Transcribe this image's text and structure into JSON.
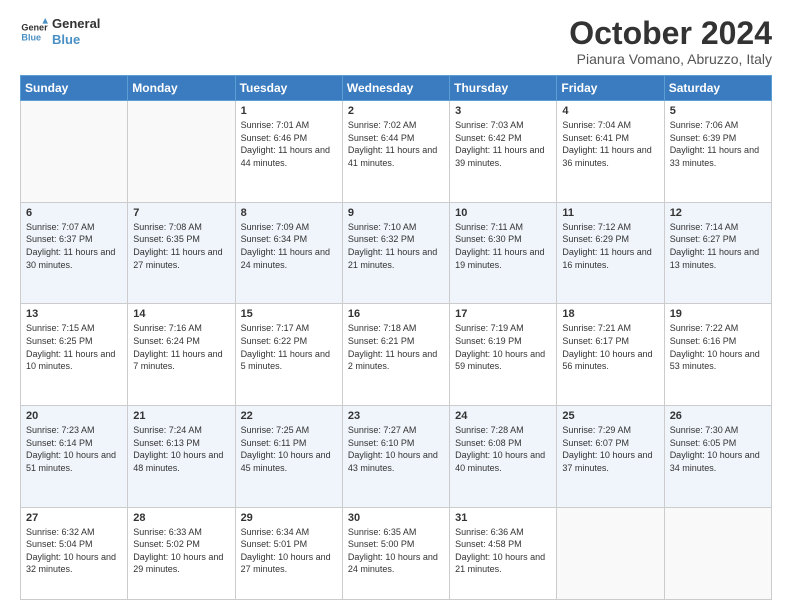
{
  "logo": {
    "line1": "General",
    "line2": "Blue"
  },
  "title": "October 2024",
  "location": "Pianura Vomano, Abruzzo, Italy",
  "weekdays": [
    "Sunday",
    "Monday",
    "Tuesday",
    "Wednesday",
    "Thursday",
    "Friday",
    "Saturday"
  ],
  "weeks": [
    [
      {
        "day": "",
        "sunrise": "",
        "sunset": "",
        "daylight": ""
      },
      {
        "day": "",
        "sunrise": "",
        "sunset": "",
        "daylight": ""
      },
      {
        "day": "1",
        "sunrise": "Sunrise: 7:01 AM",
        "sunset": "Sunset: 6:46 PM",
        "daylight": "Daylight: 11 hours and 44 minutes."
      },
      {
        "day": "2",
        "sunrise": "Sunrise: 7:02 AM",
        "sunset": "Sunset: 6:44 PM",
        "daylight": "Daylight: 11 hours and 41 minutes."
      },
      {
        "day": "3",
        "sunrise": "Sunrise: 7:03 AM",
        "sunset": "Sunset: 6:42 PM",
        "daylight": "Daylight: 11 hours and 39 minutes."
      },
      {
        "day": "4",
        "sunrise": "Sunrise: 7:04 AM",
        "sunset": "Sunset: 6:41 PM",
        "daylight": "Daylight: 11 hours and 36 minutes."
      },
      {
        "day": "5",
        "sunrise": "Sunrise: 7:06 AM",
        "sunset": "Sunset: 6:39 PM",
        "daylight": "Daylight: 11 hours and 33 minutes."
      }
    ],
    [
      {
        "day": "6",
        "sunrise": "Sunrise: 7:07 AM",
        "sunset": "Sunset: 6:37 PM",
        "daylight": "Daylight: 11 hours and 30 minutes."
      },
      {
        "day": "7",
        "sunrise": "Sunrise: 7:08 AM",
        "sunset": "Sunset: 6:35 PM",
        "daylight": "Daylight: 11 hours and 27 minutes."
      },
      {
        "day": "8",
        "sunrise": "Sunrise: 7:09 AM",
        "sunset": "Sunset: 6:34 PM",
        "daylight": "Daylight: 11 hours and 24 minutes."
      },
      {
        "day": "9",
        "sunrise": "Sunrise: 7:10 AM",
        "sunset": "Sunset: 6:32 PM",
        "daylight": "Daylight: 11 hours and 21 minutes."
      },
      {
        "day": "10",
        "sunrise": "Sunrise: 7:11 AM",
        "sunset": "Sunset: 6:30 PM",
        "daylight": "Daylight: 11 hours and 19 minutes."
      },
      {
        "day": "11",
        "sunrise": "Sunrise: 7:12 AM",
        "sunset": "Sunset: 6:29 PM",
        "daylight": "Daylight: 11 hours and 16 minutes."
      },
      {
        "day": "12",
        "sunrise": "Sunrise: 7:14 AM",
        "sunset": "Sunset: 6:27 PM",
        "daylight": "Daylight: 11 hours and 13 minutes."
      }
    ],
    [
      {
        "day": "13",
        "sunrise": "Sunrise: 7:15 AM",
        "sunset": "Sunset: 6:25 PM",
        "daylight": "Daylight: 11 hours and 10 minutes."
      },
      {
        "day": "14",
        "sunrise": "Sunrise: 7:16 AM",
        "sunset": "Sunset: 6:24 PM",
        "daylight": "Daylight: 11 hours and 7 minutes."
      },
      {
        "day": "15",
        "sunrise": "Sunrise: 7:17 AM",
        "sunset": "Sunset: 6:22 PM",
        "daylight": "Daylight: 11 hours and 5 minutes."
      },
      {
        "day": "16",
        "sunrise": "Sunrise: 7:18 AM",
        "sunset": "Sunset: 6:21 PM",
        "daylight": "Daylight: 11 hours and 2 minutes."
      },
      {
        "day": "17",
        "sunrise": "Sunrise: 7:19 AM",
        "sunset": "Sunset: 6:19 PM",
        "daylight": "Daylight: 10 hours and 59 minutes."
      },
      {
        "day": "18",
        "sunrise": "Sunrise: 7:21 AM",
        "sunset": "Sunset: 6:17 PM",
        "daylight": "Daylight: 10 hours and 56 minutes."
      },
      {
        "day": "19",
        "sunrise": "Sunrise: 7:22 AM",
        "sunset": "Sunset: 6:16 PM",
        "daylight": "Daylight: 10 hours and 53 minutes."
      }
    ],
    [
      {
        "day": "20",
        "sunrise": "Sunrise: 7:23 AM",
        "sunset": "Sunset: 6:14 PM",
        "daylight": "Daylight: 10 hours and 51 minutes."
      },
      {
        "day": "21",
        "sunrise": "Sunrise: 7:24 AM",
        "sunset": "Sunset: 6:13 PM",
        "daylight": "Daylight: 10 hours and 48 minutes."
      },
      {
        "day": "22",
        "sunrise": "Sunrise: 7:25 AM",
        "sunset": "Sunset: 6:11 PM",
        "daylight": "Daylight: 10 hours and 45 minutes."
      },
      {
        "day": "23",
        "sunrise": "Sunrise: 7:27 AM",
        "sunset": "Sunset: 6:10 PM",
        "daylight": "Daylight: 10 hours and 43 minutes."
      },
      {
        "day": "24",
        "sunrise": "Sunrise: 7:28 AM",
        "sunset": "Sunset: 6:08 PM",
        "daylight": "Daylight: 10 hours and 40 minutes."
      },
      {
        "day": "25",
        "sunrise": "Sunrise: 7:29 AM",
        "sunset": "Sunset: 6:07 PM",
        "daylight": "Daylight: 10 hours and 37 minutes."
      },
      {
        "day": "26",
        "sunrise": "Sunrise: 7:30 AM",
        "sunset": "Sunset: 6:05 PM",
        "daylight": "Daylight: 10 hours and 34 minutes."
      }
    ],
    [
      {
        "day": "27",
        "sunrise": "Sunrise: 6:32 AM",
        "sunset": "Sunset: 5:04 PM",
        "daylight": "Daylight: 10 hours and 32 minutes."
      },
      {
        "day": "28",
        "sunrise": "Sunrise: 6:33 AM",
        "sunset": "Sunset: 5:02 PM",
        "daylight": "Daylight: 10 hours and 29 minutes."
      },
      {
        "day": "29",
        "sunrise": "Sunrise: 6:34 AM",
        "sunset": "Sunset: 5:01 PM",
        "daylight": "Daylight: 10 hours and 27 minutes."
      },
      {
        "day": "30",
        "sunrise": "Sunrise: 6:35 AM",
        "sunset": "Sunset: 5:00 PM",
        "daylight": "Daylight: 10 hours and 24 minutes."
      },
      {
        "day": "31",
        "sunrise": "Sunrise: 6:36 AM",
        "sunset": "Sunset: 4:58 PM",
        "daylight": "Daylight: 10 hours and 21 minutes."
      },
      {
        "day": "",
        "sunrise": "",
        "sunset": "",
        "daylight": ""
      },
      {
        "day": "",
        "sunrise": "",
        "sunset": "",
        "daylight": ""
      }
    ]
  ]
}
